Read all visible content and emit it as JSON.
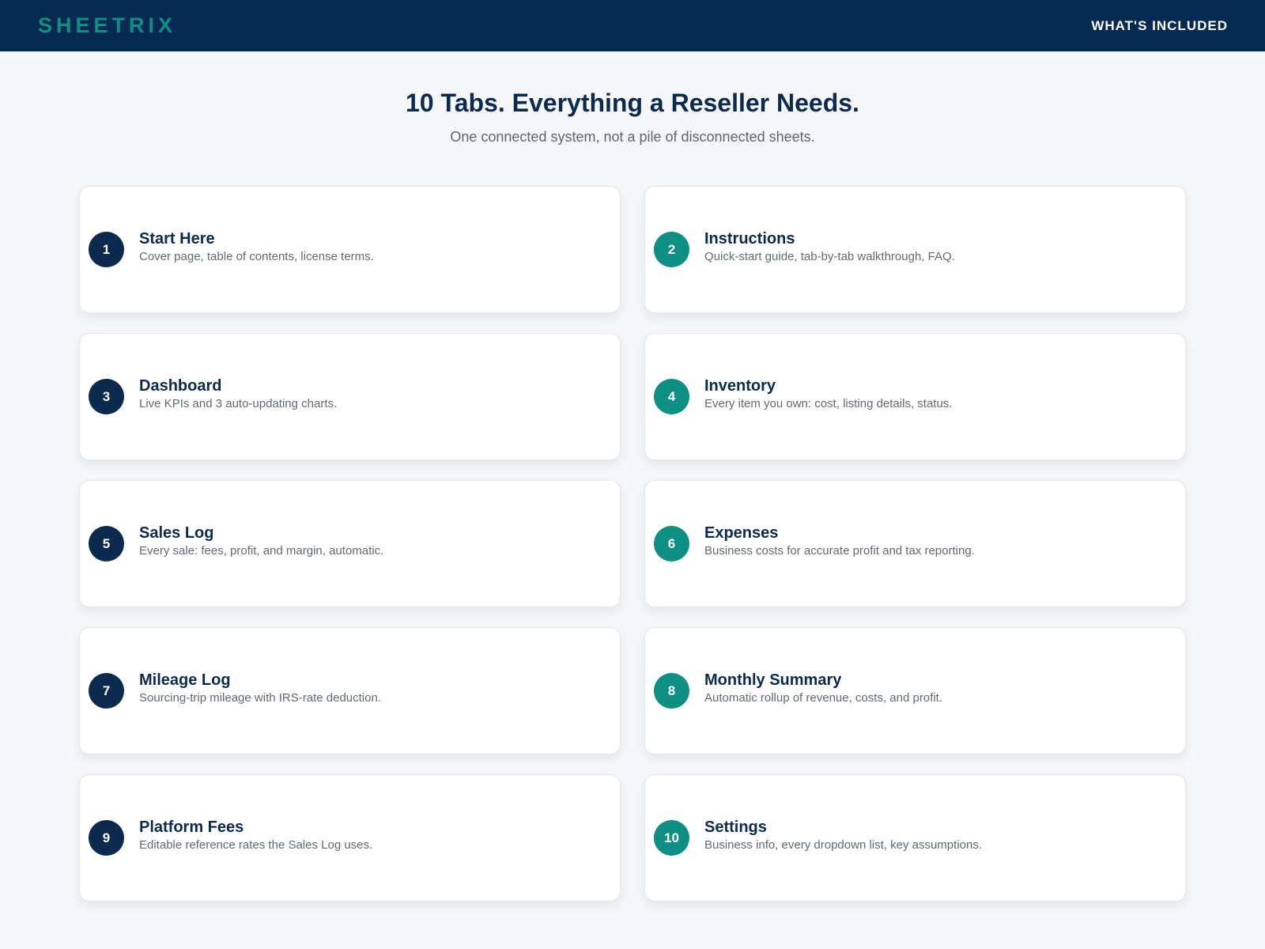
{
  "header": {
    "brand": "SHEETRIX",
    "nav_link": "WHAT'S INCLUDED"
  },
  "hero": {
    "title": "10 Tabs. Everything a Reseller Needs.",
    "subtitle": "One connected system, not a pile of disconnected sheets."
  },
  "colors": {
    "navy": "#0b2a4d",
    "teal": "#0d8f84",
    "header_bg": "#072a52",
    "page_bg": "#f5f7f9"
  },
  "tabs": [
    {
      "number": "1",
      "title": "Start Here",
      "description": "Cover page, table of contents, license terms.",
      "badge_color": "navy"
    },
    {
      "number": "2",
      "title": "Instructions",
      "description": "Quick-start guide, tab-by-tab walkthrough, FAQ.",
      "badge_color": "teal"
    },
    {
      "number": "3",
      "title": "Dashboard",
      "description": "Live KPIs and 3 auto-updating charts.",
      "badge_color": "navy"
    },
    {
      "number": "4",
      "title": "Inventory",
      "description": "Every item you own: cost, listing details, status.",
      "badge_color": "teal"
    },
    {
      "number": "5",
      "title": "Sales Log",
      "description": "Every sale: fees, profit, and margin, automatic.",
      "badge_color": "navy"
    },
    {
      "number": "6",
      "title": "Expenses",
      "description": "Business costs for accurate profit and tax reporting.",
      "badge_color": "teal"
    },
    {
      "number": "7",
      "title": "Mileage Log",
      "description": "Sourcing-trip mileage with IRS-rate deduction.",
      "badge_color": "navy"
    },
    {
      "number": "8",
      "title": "Monthly Summary",
      "description": "Automatic rollup of revenue, costs, and profit.",
      "badge_color": "teal"
    },
    {
      "number": "9",
      "title": "Platform Fees",
      "description": "Editable reference rates the Sales Log uses.",
      "badge_color": "navy"
    },
    {
      "number": "10",
      "title": "Settings",
      "description": "Business info, every dropdown list, key assumptions.",
      "badge_color": "teal"
    }
  ]
}
